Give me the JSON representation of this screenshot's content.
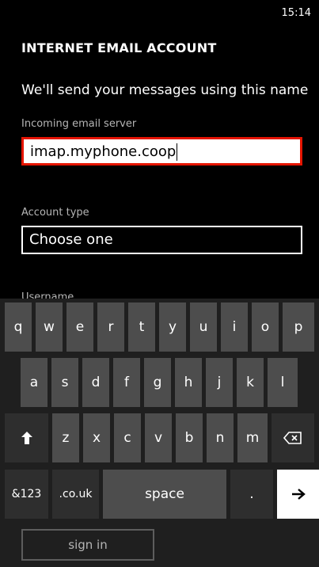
{
  "status": {
    "time": "15:14"
  },
  "page": {
    "title": "INTERNET EMAIL ACCOUNT",
    "intro": "We'll send your messages using this name"
  },
  "form": {
    "incoming_label": "Incoming email server",
    "incoming_value": "imap.myphone.coop",
    "account_type_label": "Account type",
    "account_type_value": "Choose one",
    "username_label": "Username"
  },
  "keyboard": {
    "row1": [
      "q",
      "w",
      "e",
      "r",
      "t",
      "y",
      "u",
      "i",
      "o",
      "p"
    ],
    "row2": [
      "a",
      "s",
      "d",
      "f",
      "g",
      "h",
      "j",
      "k",
      "l"
    ],
    "row3": [
      "z",
      "x",
      "c",
      "v",
      "b",
      "n",
      "m"
    ],
    "symbols_label": "&123",
    "domain_label": ".co.uk",
    "space_label": "space",
    "period_label": ".",
    "shift_icon": "shift-arrow-up-icon",
    "backspace_icon": "backspace-icon",
    "enter_icon": "arrow-right-icon"
  },
  "footer": {
    "signin_label": "sign in"
  },
  "colors": {
    "accent": "#e51400",
    "key": "#4d4d4d",
    "key_dark": "#2e2e2e"
  }
}
